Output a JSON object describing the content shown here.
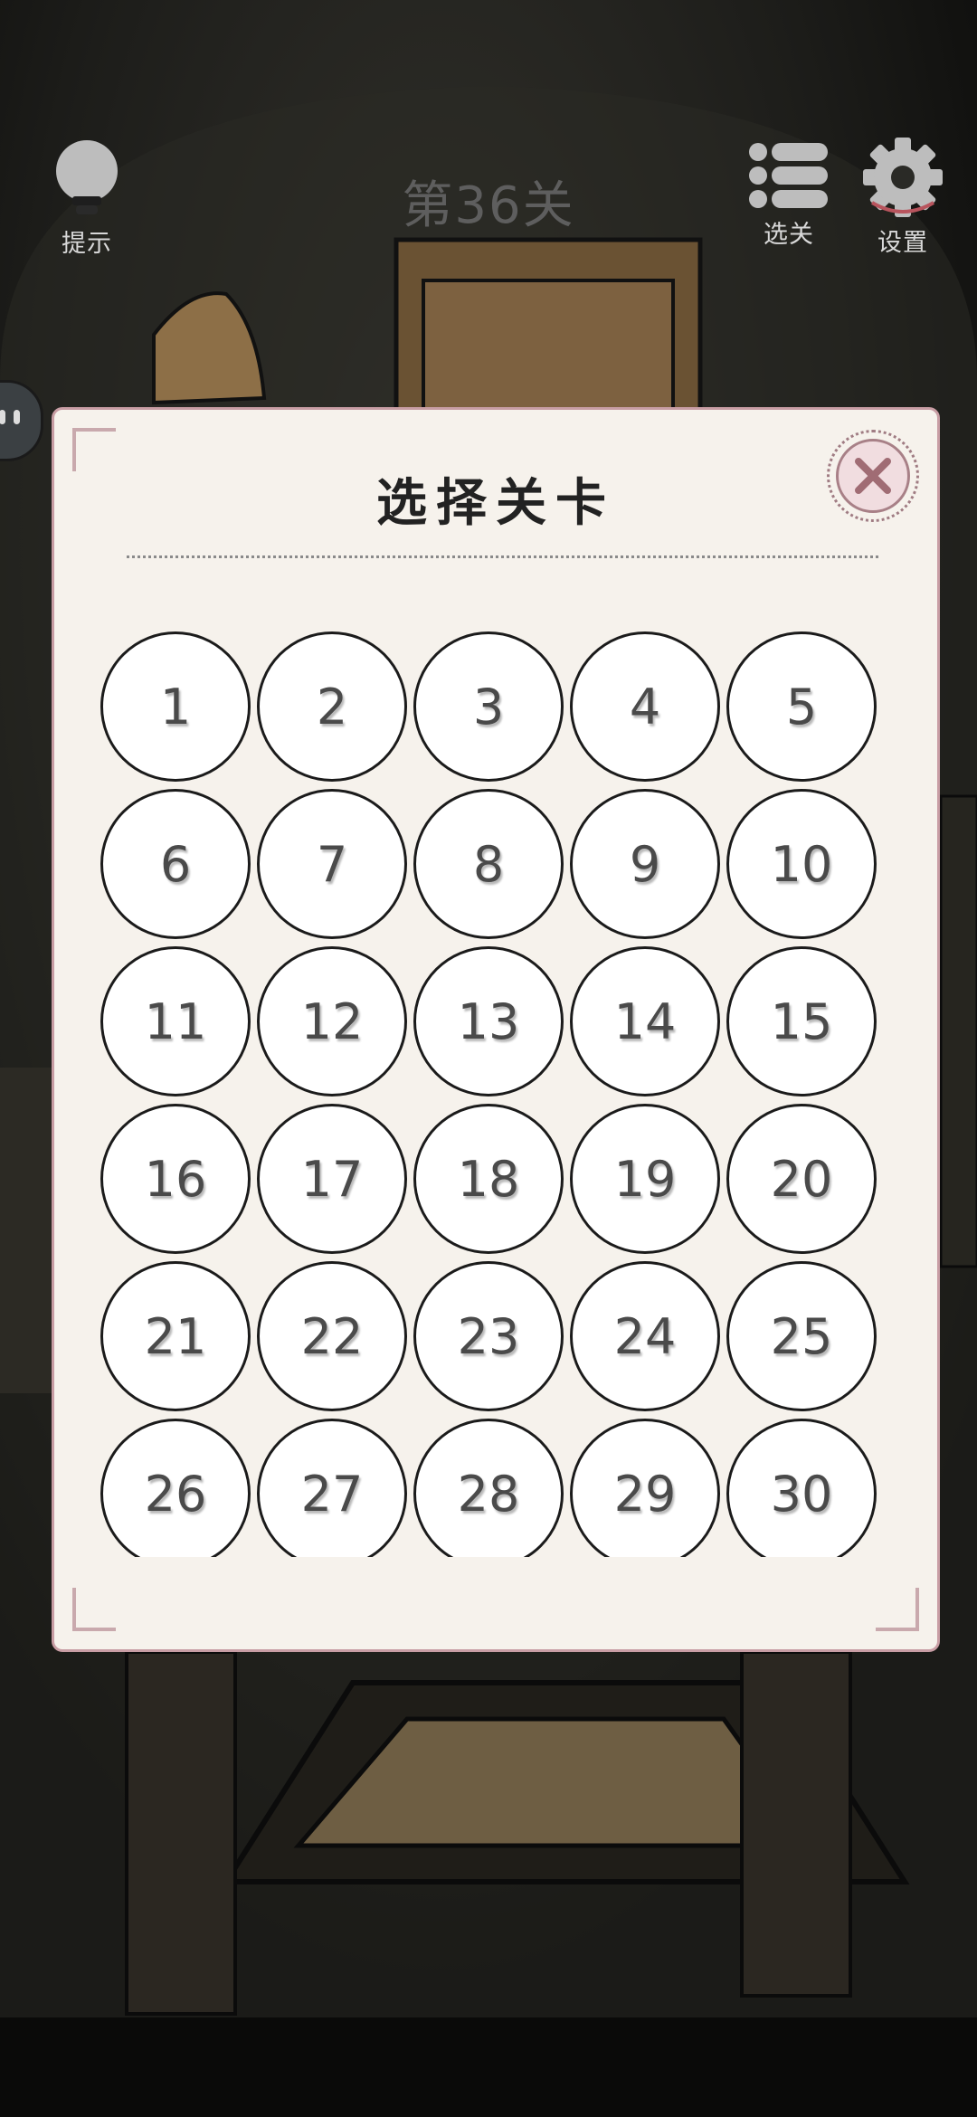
{
  "hud": {
    "hint_label": "提示",
    "level_title": "第36关",
    "level_select_label": "选关",
    "settings_label": "设置"
  },
  "icons": {
    "hint": "lightbulb-icon",
    "level_select": "list-menu-icon",
    "settings": "gear-icon",
    "close": "close-icon"
  },
  "modal": {
    "title": "选择关卡",
    "levels": [
      "1",
      "2",
      "3",
      "4",
      "5",
      "6",
      "7",
      "8",
      "9",
      "10",
      "11",
      "12",
      "13",
      "14",
      "15",
      "16",
      "17",
      "18",
      "19",
      "20",
      "21",
      "22",
      "23",
      "24",
      "25",
      "26",
      "27",
      "28",
      "29",
      "30"
    ]
  },
  "colors": {
    "modal_bg": "#f6f2ec",
    "modal_border": "#c89da4",
    "close_button": "#a88087",
    "level_text": "#4a4a4a"
  }
}
